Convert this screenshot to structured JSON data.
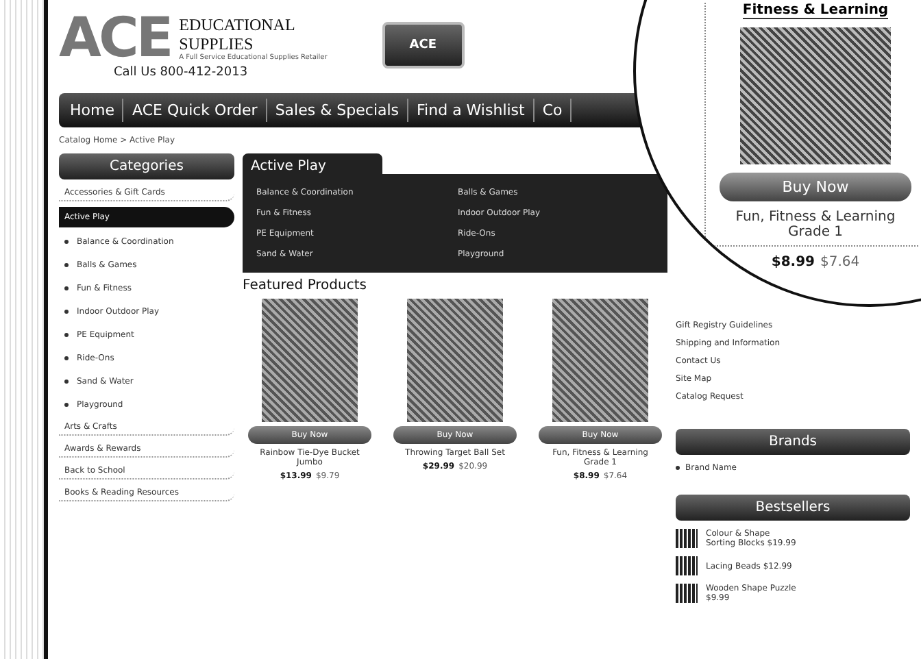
{
  "header": {
    "logo_mark": "ACE",
    "logo_name": "EDUCATIONAL SUPPLIES",
    "logo_tagline": "A Full Service Educational Supplies Retailer",
    "phone": "Call Us 800-412-2013",
    "badge": "ACE"
  },
  "nav": [
    {
      "label": "Home",
      "selected": false
    },
    {
      "label": "ACE Quick Order",
      "selected": false
    },
    {
      "label": "Sales & Specials",
      "selected": false
    },
    {
      "label": "Find a Wishlist",
      "selected": false
    },
    {
      "label": "Co",
      "selected": false
    }
  ],
  "breadcrumb": "Catalog Home > Active Play",
  "sidebar": {
    "title": "Categories",
    "items": [
      {
        "label": "Accessories & Gift Cards",
        "selected": false
      },
      {
        "label": "Active Play",
        "selected": true,
        "children": [
          {
            "label": "Balance & Coordination"
          },
          {
            "label": "Balls & Games"
          },
          {
            "label": "Fun & Fitness"
          },
          {
            "label": "Indoor Outdoor Play"
          },
          {
            "label": "PE Equipment"
          },
          {
            "label": "Ride-Ons"
          },
          {
            "label": "Sand & Water"
          },
          {
            "label": "Playground"
          }
        ]
      },
      {
        "label": "Arts & Crafts",
        "selected": false
      },
      {
        "label": "Awards & Rewards",
        "selected": false
      },
      {
        "label": "Back to School",
        "selected": false
      },
      {
        "label": "Books & Reading Resources",
        "selected": false
      }
    ]
  },
  "menu": {
    "title": "Active Play",
    "columns": [
      [
        "Balance & Coordination",
        "Fun & Fitness",
        "PE Equipment",
        "Sand & Water"
      ],
      [
        "Balls & Games",
        "Indoor Outdoor Play",
        "Ride-Ons",
        "Playground"
      ]
    ]
  },
  "featured": {
    "title": "Featured Products",
    "products": [
      {
        "button": "Buy Now",
        "name": "Rainbow Tie-Dye Bucket Jumbo",
        "price": "$13.99",
        "sale": "$9.79"
      },
      {
        "button": "Buy Now",
        "name": "Throwing Target Ball Set",
        "price": "$29.99",
        "sale": "$20.99"
      },
      {
        "button": "Buy Now",
        "name": "Fun, Fitness & Learning Grade 1",
        "price": "$8.99",
        "sale": "$7.64"
      }
    ]
  },
  "magnifier": {
    "heading": "Fitness & Learning",
    "button": "Buy Now",
    "name": "Fun, Fitness & Learning Grade 1",
    "price": "$8.99",
    "sale": "$7.64"
  },
  "links": [
    "Gift Registry Guidelines",
    "Shipping and Information",
    "Contact Us",
    "Site Map",
    "Catalog Request"
  ],
  "brands": {
    "title": "Brands",
    "items": [
      "Brand Name"
    ]
  },
  "bestsellers": {
    "title": "Bestsellers",
    "items": [
      {
        "name": "Colour & Shape Sorting Blocks",
        "price": "$19.99"
      },
      {
        "name": "Lacing Beads",
        "price": "$12.99"
      },
      {
        "name": "Wooden Shape Puzzle",
        "price": "$9.99"
      }
    ]
  }
}
